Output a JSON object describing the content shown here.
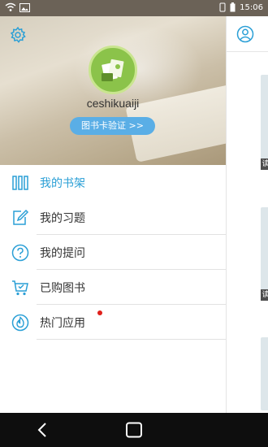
{
  "status_bar": {
    "time": "15:06",
    "icons": [
      "wifi-icon",
      "image-icon",
      "notification-icon",
      "battery-icon"
    ]
  },
  "profile": {
    "username": "ceshikuaiji",
    "verify_label": "图书卡验证 >>",
    "settings_icon": "gear-icon",
    "avatar_icon": "book-avatar-icon"
  },
  "menu": {
    "items": [
      {
        "label": "我的书架",
        "icon": "bookshelf-icon",
        "active": true
      },
      {
        "label": "我的习题",
        "icon": "edit-note-icon",
        "active": false
      },
      {
        "label": "我的提问",
        "icon": "question-icon",
        "active": false
      },
      {
        "label": "已购图书",
        "icon": "cart-icon",
        "active": false
      },
      {
        "label": "热门应用",
        "icon": "flame-icon",
        "active": false,
        "badge": "new-dot"
      }
    ]
  },
  "right_panel": {
    "header_icon": "user-icon",
    "peek_tags": [
      "读",
      "读"
    ]
  },
  "nav_bar": {
    "back_icon": "back-icon",
    "home_icon": "home-icon"
  },
  "colors": {
    "accent": "#2a9fd6",
    "verify_button": "#5aaee6",
    "badge": "#e0201b",
    "avatar": "#8bc34a"
  }
}
